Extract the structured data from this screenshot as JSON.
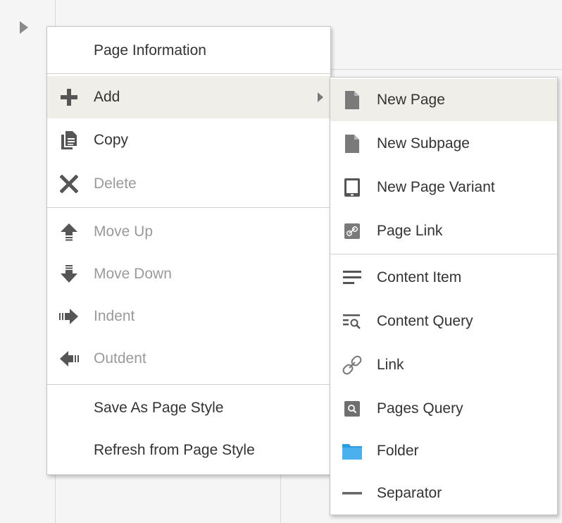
{
  "context_menu": {
    "items": {
      "page_information": {
        "label": "Page Information"
      },
      "add": {
        "label": "Add"
      },
      "copy": {
        "label": "Copy"
      },
      "delete": {
        "label": "Delete"
      },
      "move_up": {
        "label": "Move Up"
      },
      "move_down": {
        "label": "Move Down"
      },
      "indent": {
        "label": "Indent"
      },
      "outdent": {
        "label": "Outdent"
      },
      "save_as_page_style": {
        "label": "Save As Page Style"
      },
      "refresh_from_page_style": {
        "label": "Refresh from Page Style"
      }
    }
  },
  "add_submenu": {
    "items": {
      "new_page": {
        "label": "New Page"
      },
      "new_subpage": {
        "label": "New Subpage"
      },
      "new_page_variant": {
        "label": "New Page Variant"
      },
      "page_link": {
        "label": "Page Link"
      },
      "content_item": {
        "label": "Content Item"
      },
      "content_query": {
        "label": "Content Query"
      },
      "link": {
        "label": "Link"
      },
      "pages_query": {
        "label": "Pages Query"
      },
      "folder": {
        "label": "Folder"
      },
      "separator": {
        "label": "Separator"
      }
    }
  },
  "colors": {
    "highlight": "#efeee8",
    "icon_dark": "#555555",
    "icon_disabled": "#8a8a8a",
    "folder_blue": "#2e9de0",
    "page_grey": "#7a7a7a"
  }
}
